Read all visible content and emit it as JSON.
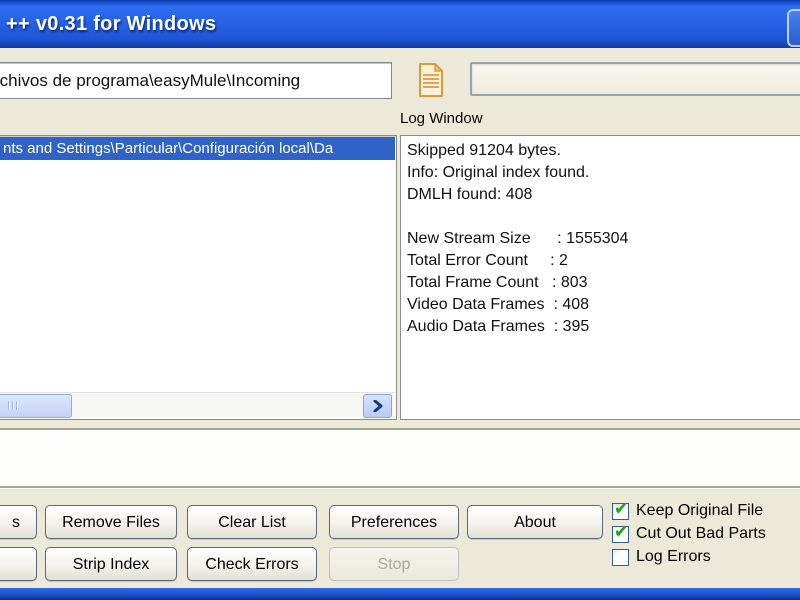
{
  "window": {
    "title": "++ v0.31 for Windows"
  },
  "toolbar": {
    "path_input_value": "rchivos de programa\\easyMule\\Incoming"
  },
  "file_list": {
    "selected_item": "nts and Settings\\Particular\\Configuración local\\Da"
  },
  "log": {
    "label": "Log Window",
    "lines": [
      "Skipped 91204 bytes.",
      "Info: Original index found.",
      "DMLH found: 408",
      "",
      "New Stream Size      : 1555304",
      "Total Error Count     : 2",
      "Total Frame Count   : 803",
      "Video Data Frames  : 408",
      "Audio Data Frames  : 395"
    ]
  },
  "buttons": {
    "row1": [
      {
        "label": "s"
      },
      {
        "label": "Remove Files"
      },
      {
        "label": "Clear List"
      },
      {
        "label": "Preferences"
      },
      {
        "label": "About"
      }
    ],
    "row2": [
      {
        "label": ""
      },
      {
        "label": "Strip Index"
      },
      {
        "label": "Check Errors"
      },
      {
        "label": "Stop"
      }
    ]
  },
  "checkboxes": [
    {
      "label": "Keep Original File",
      "checked": true,
      "mark": "✔"
    },
    {
      "label": "Cut Out Bad Parts",
      "checked": true,
      "mark": "✔"
    },
    {
      "label": "Log Errors",
      "checked": false,
      "mark": ""
    }
  ],
  "colors": {
    "titlebar_blue": "#2561e4",
    "selection_blue": "#2f63c8",
    "background_beige": "#ece9d8",
    "check_green": "#1ea11e"
  }
}
